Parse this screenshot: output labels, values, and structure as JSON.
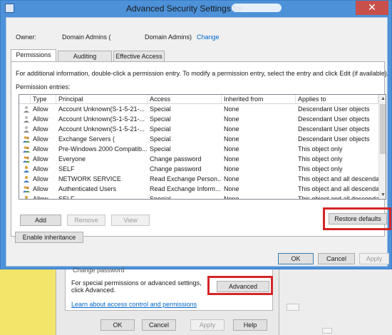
{
  "window": {
    "title": "Advanced Security Settings for",
    "close_glyph": "✕"
  },
  "owner": {
    "label": "Owner:",
    "name": "Domain Admins (",
    "name_suffix": "Domain Admins)",
    "change_label": "Change"
  },
  "tabs": [
    {
      "label": "Permissions",
      "active": true
    },
    {
      "label": "Auditing",
      "active": false
    },
    {
      "label": "Effective Access",
      "active": false
    }
  ],
  "info_text": "For additional information, double-click a permission entry. To modify a permission entry, select the entry and click Edit (if available).",
  "entries_label": "Permission entries:",
  "columns": [
    "Type",
    "Principal",
    "Access",
    "Inherited from",
    "Applies to"
  ],
  "entries": [
    {
      "type": "Allow",
      "principal": "Account Unknown(S-1-5-21-...",
      "access": "Special",
      "inherited": "None",
      "applies": "Descendant User objects",
      "icon": "unknown-user-icon"
    },
    {
      "type": "Allow",
      "principal": "Account Unknown(S-1-5-21-...",
      "access": "Special",
      "inherited": "None",
      "applies": "Descendant User objects",
      "icon": "unknown-user-icon"
    },
    {
      "type": "Allow",
      "principal": "Account Unknown(S-1-5-21-...",
      "access": "Special",
      "inherited": "None",
      "applies": "Descendant User objects",
      "icon": "unknown-user-icon"
    },
    {
      "type": "Allow",
      "principal": "Exchange Servers (",
      "access": "Special",
      "inherited": "None",
      "applies": "Descendant User objects",
      "icon": "group-icon"
    },
    {
      "type": "Allow",
      "principal": "Pre-Windows 2000 Compatib...",
      "access": "Special",
      "inherited": "None",
      "applies": "This object only",
      "icon": "group-icon"
    },
    {
      "type": "Allow",
      "principal": "Everyone",
      "access": "Change password",
      "inherited": "None",
      "applies": "This object only",
      "icon": "group-icon"
    },
    {
      "type": "Allow",
      "principal": "SELF",
      "access": "Change password",
      "inherited": "None",
      "applies": "This object only",
      "icon": "user-icon"
    },
    {
      "type": "Allow",
      "principal": "NETWORK SERVICE",
      "access": "Read Exchange Person...",
      "inherited": "None",
      "applies": "This object and all descendan...",
      "icon": "user-icon"
    },
    {
      "type": "Allow",
      "principal": "Authenticated Users",
      "access": "Read Exchange Inform...",
      "inherited": "None",
      "applies": "This object and all descendan...",
      "icon": "group-icon"
    },
    {
      "type": "Allow",
      "principal": "SELF",
      "access": "Special",
      "inherited": "None",
      "applies": "This object and all descendan...",
      "icon": "user-icon"
    }
  ],
  "buttons": {
    "add": "Add",
    "remove": "Remove",
    "view": "View",
    "restore_defaults": "Restore defaults",
    "enable_inheritance": "Enable inheritance",
    "ok": "OK",
    "cancel": "Cancel",
    "apply": "Apply"
  },
  "lower_dialog": {
    "clipped_text": "Change password",
    "advanced_text": "For special permissions or advanced settings, click Advanced.",
    "advanced_button": "Advanced",
    "learn_link": "Learn about access control and permissions",
    "ok": "OK",
    "cancel": "Cancel",
    "apply": "Apply",
    "help": "Help"
  },
  "colors": {
    "highlight_box": "#d32626",
    "window_frame": "#4d91d9",
    "link": "#0066cc",
    "close_button": "#c7504b"
  }
}
